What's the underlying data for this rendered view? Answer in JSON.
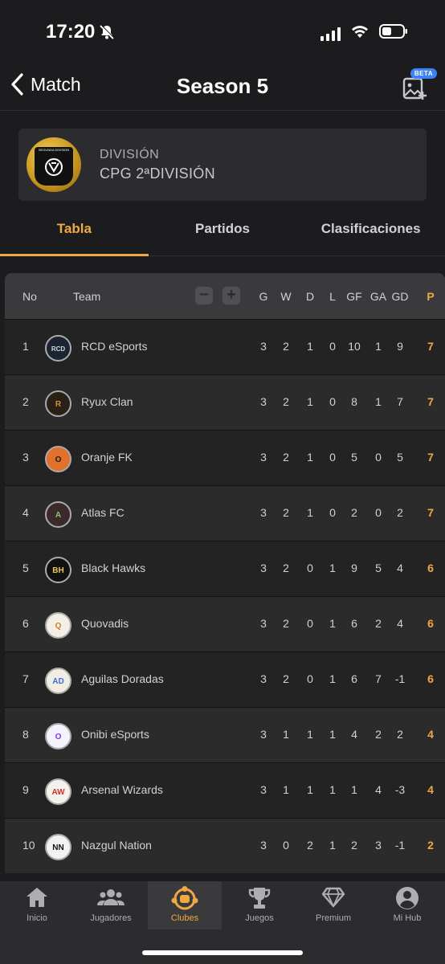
{
  "status": {
    "time": "17:20"
  },
  "nav": {
    "back_label": "Match",
    "title": "Season 5",
    "beta_badge": "BETA"
  },
  "division": {
    "label": "DIVISIÓN",
    "value": "CPG 2ªDIVISIÓN",
    "badge_text": "SEGUNDA DIVISION"
  },
  "tabs": [
    {
      "label": "Tabla",
      "active": true
    },
    {
      "label": "Partidos",
      "active": false
    },
    {
      "label": "Clasificaciones",
      "active": false
    }
  ],
  "table": {
    "headers": {
      "no": "No",
      "team": "Team",
      "g": "G",
      "w": "W",
      "d": "D",
      "l": "L",
      "gf": "GF",
      "ga": "GA",
      "gd": "GD",
      "p": "P",
      "minus": "−",
      "plus": "+"
    },
    "rows": [
      {
        "no": "1",
        "team": "RCD eSports",
        "g": "3",
        "w": "2",
        "d": "1",
        "l": "0",
        "gf": "10",
        "ga": "1",
        "gd": "9",
        "p": "7"
      },
      {
        "no": "2",
        "team": "Ryux Clan",
        "g": "3",
        "w": "2",
        "d": "1",
        "l": "0",
        "gf": "8",
        "ga": "1",
        "gd": "7",
        "p": "7"
      },
      {
        "no": "3",
        "team": "Oranje FK",
        "g": "3",
        "w": "2",
        "d": "1",
        "l": "0",
        "gf": "5",
        "ga": "0",
        "gd": "5",
        "p": "7"
      },
      {
        "no": "4",
        "team": "Atlas FC",
        "g": "3",
        "w": "2",
        "d": "1",
        "l": "0",
        "gf": "2",
        "ga": "0",
        "gd": "2",
        "p": "7"
      },
      {
        "no": "5",
        "team": "Black Hawks",
        "g": "3",
        "w": "2",
        "d": "0",
        "l": "1",
        "gf": "9",
        "ga": "5",
        "gd": "4",
        "p": "6"
      },
      {
        "no": "6",
        "team": "Quovadis",
        "g": "3",
        "w": "2",
        "d": "0",
        "l": "1",
        "gf": "6",
        "ga": "2",
        "gd": "4",
        "p": "6"
      },
      {
        "no": "7",
        "team": "Aguilas Doradas",
        "g": "3",
        "w": "2",
        "d": "0",
        "l": "1",
        "gf": "6",
        "ga": "7",
        "gd": "-1",
        "p": "6"
      },
      {
        "no": "8",
        "team": "Onibi eSports",
        "g": "3",
        "w": "1",
        "d": "1",
        "l": "1",
        "gf": "4",
        "ga": "2",
        "gd": "2",
        "p": "4"
      },
      {
        "no": "9",
        "team": "Arsenal Wizards",
        "g": "3",
        "w": "1",
        "d": "1",
        "l": "1",
        "gf": "1",
        "ga": "4",
        "gd": "-3",
        "p": "4"
      },
      {
        "no": "10",
        "team": "Nazgul Nation",
        "g": "3",
        "w": "0",
        "d": "2",
        "l": "1",
        "gf": "2",
        "ga": "3",
        "gd": "-1",
        "p": "2"
      }
    ]
  },
  "tabbar": [
    {
      "label": "Inicio",
      "icon": "home-icon",
      "active": false
    },
    {
      "label": "Jugadores",
      "icon": "players-icon",
      "active": false
    },
    {
      "label": "Clubes",
      "icon": "clubs-icon",
      "active": true
    },
    {
      "label": "Juegos",
      "icon": "trophy-icon",
      "active": false
    },
    {
      "label": "Premium",
      "icon": "diamond-icon",
      "active": false
    },
    {
      "label": "Mi Hub",
      "icon": "profile-icon",
      "active": false
    }
  ],
  "colors": {
    "accent": "#f0a844",
    "background": "#1c1c1e",
    "beta": "#3b82f6"
  }
}
